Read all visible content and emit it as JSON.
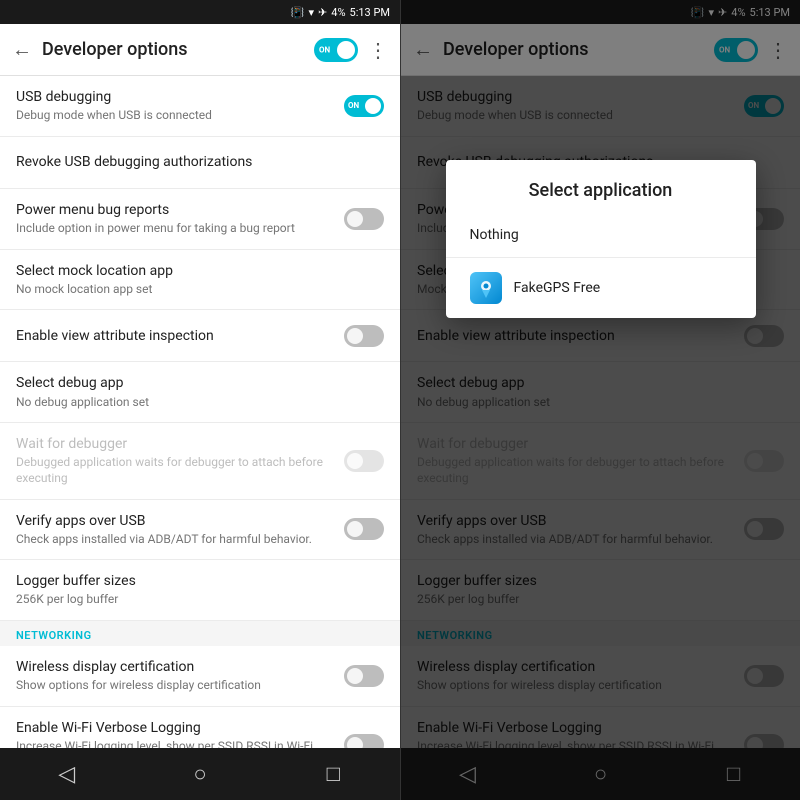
{
  "statusBar": {
    "battery": "4%",
    "time": "5:13 PM"
  },
  "panels": [
    {
      "id": "left",
      "toolbar": {
        "backLabel": "←",
        "title": "Developer options",
        "moreLabel": "⋮"
      },
      "items": [
        {
          "id": "usb-debugging",
          "title": "USB debugging",
          "subtitle": "Debug mode when USB is connected",
          "control": "toggle-on",
          "disabled": false
        },
        {
          "id": "revoke-usb",
          "title": "Revoke USB debugging authorizations",
          "subtitle": "",
          "control": "none",
          "disabled": false
        },
        {
          "id": "power-menu-bug",
          "title": "Power menu bug reports",
          "subtitle": "Include option in power menu for taking a bug report",
          "control": "toggle-off",
          "disabled": false
        },
        {
          "id": "mock-location",
          "title": "Select mock location app",
          "subtitle": "No mock location app set",
          "control": "none",
          "disabled": false
        },
        {
          "id": "view-attribute",
          "title": "Enable view attribute inspection",
          "subtitle": "",
          "control": "toggle-off",
          "disabled": false
        },
        {
          "id": "debug-app",
          "title": "Select debug app",
          "subtitle": "No debug application set",
          "control": "none",
          "disabled": false
        },
        {
          "id": "wait-debugger",
          "title": "Wait for debugger",
          "subtitle": "Debugged application waits for debugger to attach before executing",
          "control": "toggle-off-disabled",
          "disabled": true
        },
        {
          "id": "verify-apps",
          "title": "Verify apps over USB",
          "subtitle": "Check apps installed via ADB/ADT for harmful behavior.",
          "control": "toggle-off",
          "disabled": false
        },
        {
          "id": "logger-buffer",
          "title": "Logger buffer sizes",
          "subtitle": "256K per log buffer",
          "control": "none",
          "disabled": false
        }
      ],
      "sections": [
        {
          "id": "networking",
          "label": "NETWORKING",
          "afterItemId": "logger-buffer"
        }
      ],
      "networkingItems": [
        {
          "id": "wireless-cert",
          "title": "Wireless display certification",
          "subtitle": "Show options for wireless display certification",
          "control": "toggle-off",
          "disabled": false
        },
        {
          "id": "wifi-verbose",
          "title": "Enable Wi-Fi Verbose Logging",
          "subtitle": "Increase Wi-Fi logging level, show per SSID RSSI in Wi-Fi Picker",
          "control": "toggle-off",
          "disabled": false
        }
      ],
      "bottomNav": {
        "back": "◁",
        "home": "○",
        "recent": "□"
      }
    },
    {
      "id": "right",
      "toolbar": {
        "backLabel": "←",
        "title": "Developer options",
        "moreLabel": "⋮"
      },
      "items": [
        {
          "id": "usb-debugging",
          "title": "USB debugging",
          "subtitle": "Debug mode when USB is connected",
          "control": "toggle-on",
          "disabled": false
        },
        {
          "id": "revoke-usb",
          "title": "Revoke USB debugging authorizations",
          "subtitle": "",
          "control": "none",
          "disabled": false
        },
        {
          "id": "power-menu-bug",
          "title": "Power menu bug reports",
          "subtitle": "Include option in power menu for taking a bug report",
          "control": "toggle-off",
          "disabled": false
        },
        {
          "id": "mock-location",
          "title": "Select mock location app",
          "subtitle": "Mock location app: FakeGPS Free",
          "control": "none",
          "disabled": false
        },
        {
          "id": "view-attribute",
          "title": "Enable view attribute inspection",
          "subtitle": "",
          "control": "toggle-off",
          "disabled": false
        },
        {
          "id": "debug-app",
          "title": "Select debug app",
          "subtitle": "No debug application set",
          "control": "none",
          "disabled": false
        },
        {
          "id": "wait-debugger",
          "title": "Wait for debugger",
          "subtitle": "Debugged application waits for debugger to attach before executing",
          "control": "toggle-off-disabled",
          "disabled": true
        },
        {
          "id": "verify-apps",
          "title": "Verify apps over USB",
          "subtitle": "Check apps installed via ADB/ADT for harmful behavior.",
          "control": "toggle-off",
          "disabled": false
        },
        {
          "id": "logger-buffer",
          "title": "Logger buffer sizes",
          "subtitle": "256K per log buffer",
          "control": "none",
          "disabled": false
        }
      ],
      "networkingItems": [
        {
          "id": "wireless-cert",
          "title": "Wireless display certification",
          "subtitle": "Show options for wireless display certification",
          "control": "toggle-off",
          "disabled": false
        },
        {
          "id": "wifi-verbose",
          "title": "Enable Wi-Fi Verbose Logging",
          "subtitle": "Increase Wi-Fi logging level, show per SSID RSSI in Wi-Fi Picker",
          "control": "toggle-off",
          "disabled": false
        }
      ],
      "dialog": {
        "title": "Select application",
        "items": [
          {
            "id": "nothing",
            "label": "Nothing",
            "hasIcon": false
          },
          {
            "id": "fakegps",
            "label": "FakeGPS Free",
            "hasIcon": true
          }
        ]
      },
      "bottomNav": {
        "back": "◁",
        "home": "○",
        "recent": "□"
      }
    }
  ]
}
